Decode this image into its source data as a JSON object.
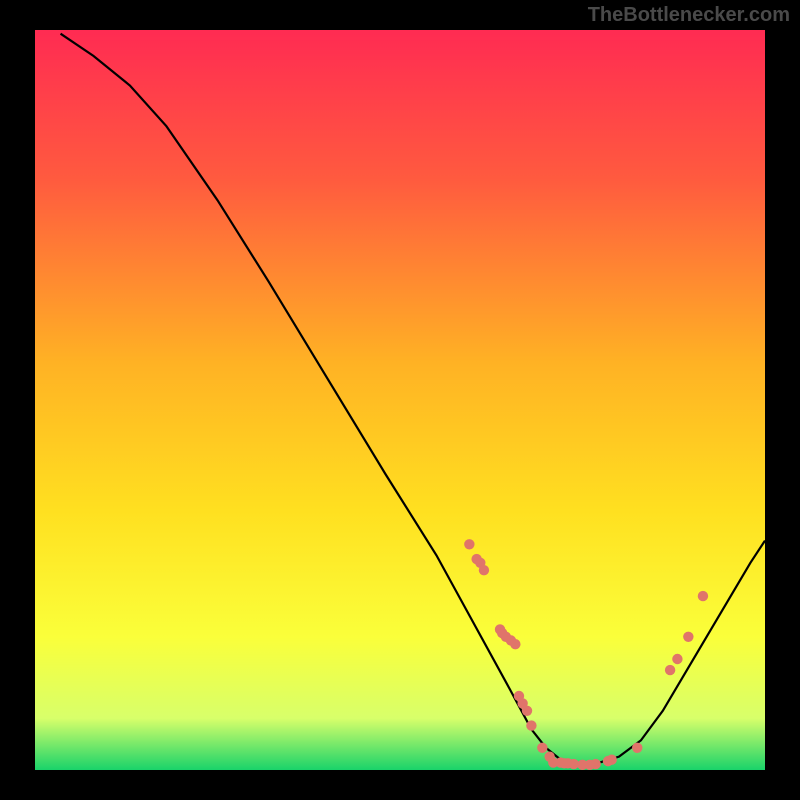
{
  "attribution": "TheBottlenecker.com",
  "chart_data": {
    "type": "line",
    "title": "",
    "xlabel": "",
    "ylabel": "",
    "xlim": [
      0,
      100
    ],
    "ylim": [
      0,
      100
    ],
    "gradient_stops": [
      {
        "offset": 0,
        "color": "#ff2b52"
      },
      {
        "offset": 20,
        "color": "#ff5a3f"
      },
      {
        "offset": 45,
        "color": "#ffb224"
      },
      {
        "offset": 65,
        "color": "#ffe020"
      },
      {
        "offset": 82,
        "color": "#faff3a"
      },
      {
        "offset": 93,
        "color": "#d8ff6a"
      },
      {
        "offset": 100,
        "color": "#19d36a"
      }
    ],
    "curve": [
      {
        "x": 3.5,
        "y": 99.5
      },
      {
        "x": 8,
        "y": 96.5
      },
      {
        "x": 13,
        "y": 92.5
      },
      {
        "x": 18,
        "y": 87
      },
      {
        "x": 25,
        "y": 77
      },
      {
        "x": 32,
        "y": 66
      },
      {
        "x": 40,
        "y": 53
      },
      {
        "x": 48,
        "y": 40
      },
      {
        "x": 55,
        "y": 29
      },
      {
        "x": 60,
        "y": 20
      },
      {
        "x": 65,
        "y": 11
      },
      {
        "x": 68,
        "y": 5.5
      },
      {
        "x": 70,
        "y": 3
      },
      {
        "x": 72,
        "y": 1.4
      },
      {
        "x": 74.5,
        "y": 0.8
      },
      {
        "x": 77,
        "y": 0.9
      },
      {
        "x": 80,
        "y": 1.8
      },
      {
        "x": 83,
        "y": 4
      },
      {
        "x": 86,
        "y": 8
      },
      {
        "x": 89,
        "y": 13
      },
      {
        "x": 92,
        "y": 18
      },
      {
        "x": 95,
        "y": 23
      },
      {
        "x": 98,
        "y": 28
      },
      {
        "x": 100,
        "y": 31
      }
    ],
    "dots": [
      {
        "x": 59.5,
        "y": 30.5
      },
      {
        "x": 60.5,
        "y": 28.5
      },
      {
        "x": 61.0,
        "y": 28.0
      },
      {
        "x": 61.5,
        "y": 27.0
      },
      {
        "x": 63.7,
        "y": 19.0
      },
      {
        "x": 64.0,
        "y": 18.5
      },
      {
        "x": 64.5,
        "y": 18.0
      },
      {
        "x": 65.2,
        "y": 17.5
      },
      {
        "x": 65.8,
        "y": 17.0
      },
      {
        "x": 66.3,
        "y": 10.0
      },
      {
        "x": 66.8,
        "y": 9.0
      },
      {
        "x": 67.4,
        "y": 8.0
      },
      {
        "x": 68.0,
        "y": 6.0
      },
      {
        "x": 69.5,
        "y": 3.0
      },
      {
        "x": 70.5,
        "y": 1.8
      },
      {
        "x": 71.0,
        "y": 1.0
      },
      {
        "x": 72.0,
        "y": 1.0
      },
      {
        "x": 72.5,
        "y": 0.9
      },
      {
        "x": 73.0,
        "y": 0.9
      },
      {
        "x": 73.8,
        "y": 0.8
      },
      {
        "x": 75.0,
        "y": 0.7
      },
      {
        "x": 76.0,
        "y": 0.7
      },
      {
        "x": 76.8,
        "y": 0.8
      },
      {
        "x": 78.5,
        "y": 1.2
      },
      {
        "x": 79.0,
        "y": 1.4
      },
      {
        "x": 82.5,
        "y": 3.0
      },
      {
        "x": 87.0,
        "y": 13.5
      },
      {
        "x": 88.0,
        "y": 15.0
      },
      {
        "x": 89.5,
        "y": 18.0
      },
      {
        "x": 91.5,
        "y": 23.5
      }
    ]
  }
}
